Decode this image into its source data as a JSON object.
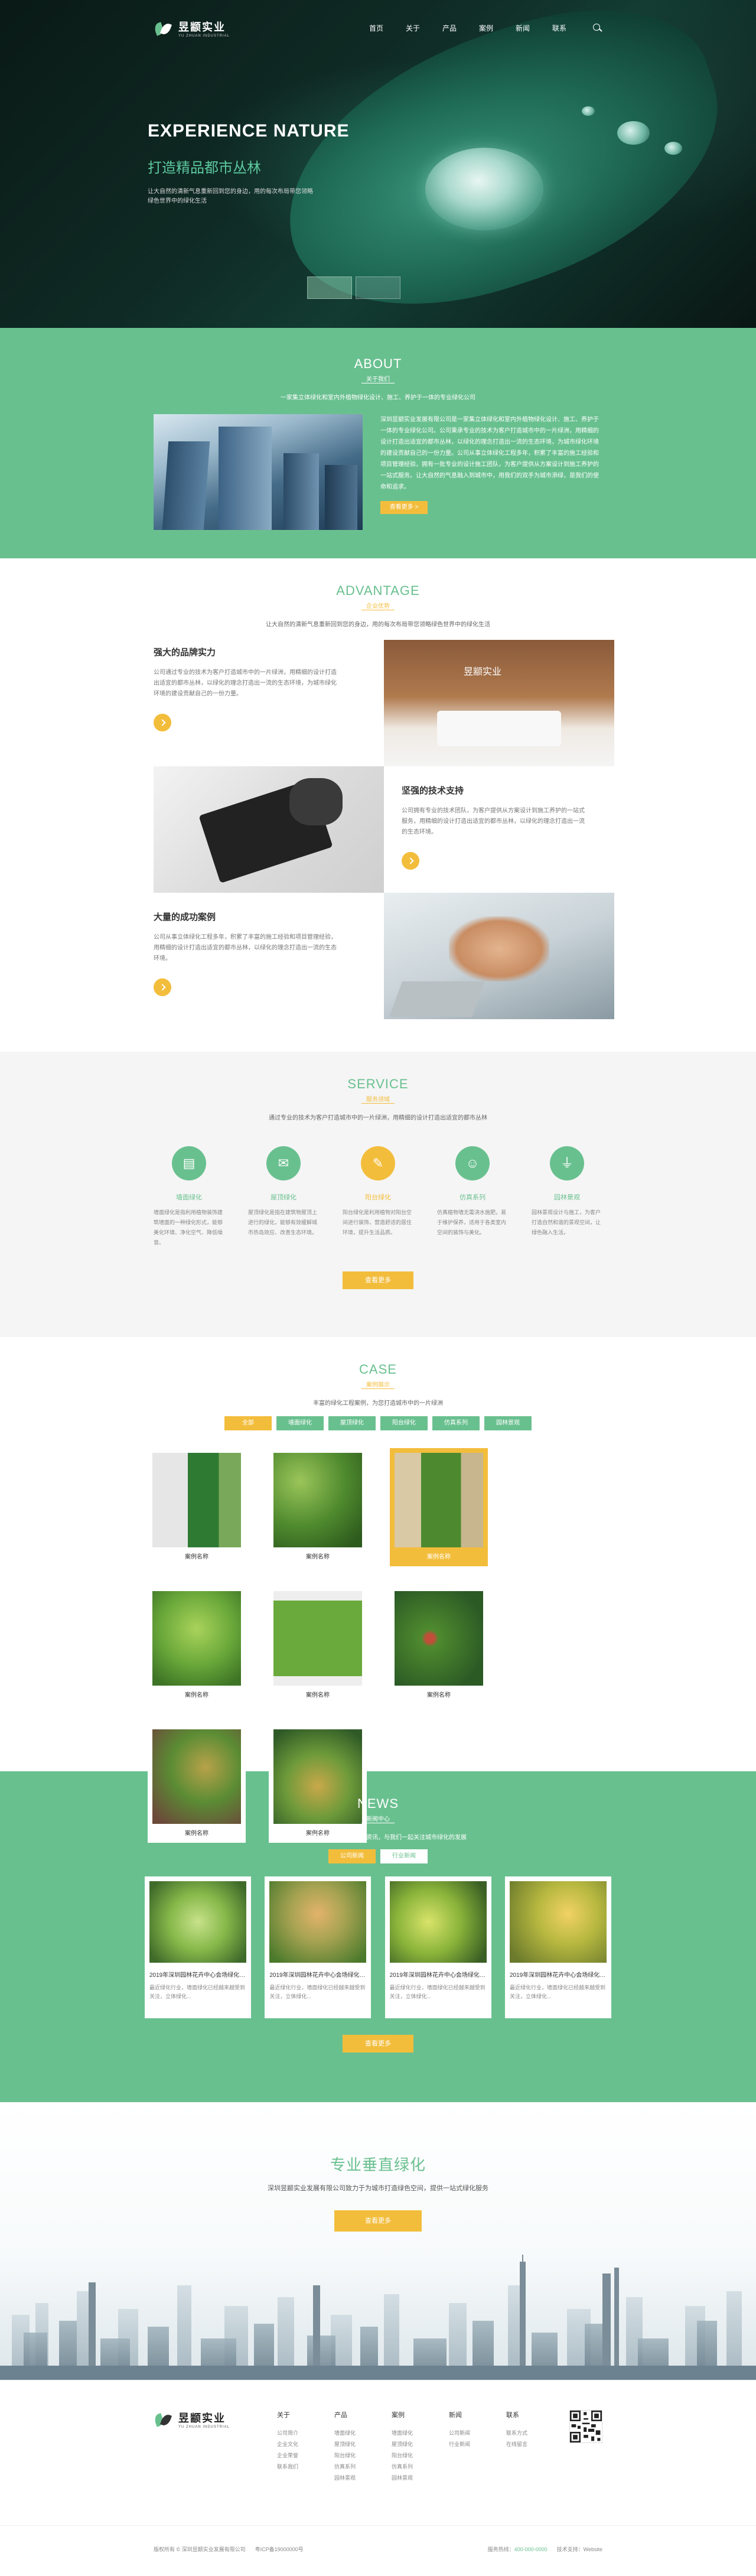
{
  "colors": {
    "green": "#69c08f",
    "gold": "#f3bd3c"
  },
  "brand": {
    "name_cn": "昱颛实业",
    "name_en": "YU ZHUAN INDUSTRIAL"
  },
  "nav": {
    "items": [
      "首页",
      "关于",
      "产品",
      "案例",
      "新闻",
      "联系"
    ],
    "search_icon": "search-icon"
  },
  "hero": {
    "title": "EXPERIENCE NATURE",
    "subtitle": "打造精品都市丛林",
    "text": "让大自然的清新气息重新回到您的身边，用的每次布局带您领略绿色世界中的绿化生活"
  },
  "about": {
    "title": "ABOUT",
    "subtitle": "关于我们",
    "desc": "一家集立体绿化和室内外植物绿化设计、施工、养护于一体的专业绿化公司",
    "text": "深圳昱颛实业发展有限公司是一家集立体绿化和室内外植物绿化设计、施工、养护于一体的专业绿化公司。公司秉承专业的技术为客户打造城市中的一片绿洲，用精细的设计打造出适宜的都市丛林，以绿化的理念打造出一流的生态环境，为城市绿化环境的建设贡献自己的一份力量。公司从事立体绿化工程多年，积累了丰富的施工经验和项目管理经验，拥有一批专业的设计施工团队，为客户提供从方案设计到施工养护的一站式服务。让大自然的气息融入到城市中，用我们的双手为城市添绿，是我们的使命和追求。",
    "button": "查看更多 >"
  },
  "advantage": {
    "title": "ADVANTAGE",
    "subtitle": "企业优势",
    "desc": "让大自然的清新气息重新回到您的身边，用的每次布局带您领略绿色世界中的绿化生活",
    "items": [
      {
        "title": "强大的品牌实力",
        "text": "公司通过专业的技术为客户打造城市中的一片绿洲，用精细的设计打造出适宜的都市丛林，以绿化的理念打造出一流的生态环境，为城市绿化环境的建设贡献自己的一份力量。"
      },
      {
        "title": "坚强的技术支持",
        "text": "公司拥有专业的技术团队，为客户提供从方案设计到施工养护的一站式服务，用精细的设计打造出适宜的都市丛林，以绿化的理念打造出一流的生态环境。"
      },
      {
        "title": "大量的成功案例",
        "text": "公司从事立体绿化工程多年，积累了丰富的施工经验和项目管理经验，用精细的设计打造出适宜的都市丛林，以绿化的理念打造出一流的生态环境。"
      }
    ]
  },
  "service": {
    "title": "SERVICE",
    "subtitle": "服务领域",
    "desc": "通过专业的技术为客户打造城市中的一片绿洲，用精细的设计打造出适宜的都市丛林",
    "items": [
      {
        "name": "墙面绿化",
        "text": "墙面绿化是指利用植物装饰建筑墙面的一种绿化形式，能够美化环境、净化空气、降低噪音。"
      },
      {
        "name": "屋顶绿化",
        "text": "屋顶绿化是指在建筑物屋顶上进行的绿化，能够有效缓解城市热岛效应、改善生态环境。"
      },
      {
        "name": "阳台绿化",
        "text": "阳台绿化是利用植物对阳台空间进行装饰，营造舒适的居住环境，提升生活品质。"
      },
      {
        "name": "仿真系列",
        "text": "仿真植物墙无需浇水施肥，易于维护保养，适用于各类室内空间的装饰与美化。"
      },
      {
        "name": "园林景观",
        "text": "园林景观设计与施工，为客户打造自然和谐的景观空间，让绿色融入生活。"
      }
    ],
    "button": "查看更多"
  },
  "case": {
    "title": "CASE",
    "subtitle": "案例展示",
    "desc": "丰富的绿化工程案例，为您打造城市中的一片绿洲",
    "tabs": [
      "全部",
      "墙面绿化",
      "屋顶绿化",
      "阳台绿化",
      "仿真系列",
      "园林景观"
    ],
    "items": [
      "案例名称",
      "案例名称",
      "案例名称",
      "案例名称",
      "案例名称",
      "案例名称",
      "案例名称",
      "案例名称"
    ]
  },
  "news": {
    "title": "NEWS",
    "subtitle": "新闻中心",
    "desc": "及时了解行业动态与公司最新资讯，与我们一起关注城市绿化的发展",
    "tabs": [
      "公司新闻",
      "行业新闻"
    ],
    "items": [
      {
        "title": "2019年深圳园林花卉中心会场绿化布置",
        "text": "最近绿化行业，墙面绿化已经越来越受到关注，立体绿化..."
      },
      {
        "title": "2019年深圳园林花卉中心会场绿化布置",
        "text": "最近绿化行业，墙面绿化已经越来越受到关注，立体绿化..."
      },
      {
        "title": "2019年深圳园林花卉中心会场绿化布置",
        "text": "最近绿化行业，墙面绿化已经越来越受到关注，立体绿化..."
      },
      {
        "title": "2019年深圳园林花卉中心会场绿化布置",
        "text": "最近绿化行业，墙面绿化已经越来越受到关注，立体绿化..."
      }
    ],
    "button": "查看更多"
  },
  "cta": {
    "title": "专业垂直绿化",
    "desc": "深圳昱颛实业发展有限公司致力于为城市打造绿色空间，提供一站式绿化服务",
    "button": "查看更多"
  },
  "footer": {
    "columns": [
      {
        "title": "关于",
        "links": [
          "公司简介",
          "企业文化",
          "企业荣誉",
          "联系我们"
        ]
      },
      {
        "title": "产品",
        "links": [
          "墙面绿化",
          "屋顶绿化",
          "阳台绿化",
          "仿真系列",
          "园林景观"
        ]
      },
      {
        "title": "案例",
        "links": [
          "墙面绿化",
          "屋顶绿化",
          "阳台绿化",
          "仿真系列",
          "园林景观"
        ]
      },
      {
        "title": "新闻",
        "links": [
          "公司新闻",
          "行业新闻"
        ]
      },
      {
        "title": "联系",
        "links": [
          "联系方式",
          "在线留言"
        ]
      }
    ],
    "copyright": "版权所有 © 深圳昱颛实业发展有限公司",
    "icp": "粤ICP备19000000号",
    "hotline_label": "服务热线：",
    "hotline": "400-000-0000",
    "tech": "技术支持：Website"
  }
}
